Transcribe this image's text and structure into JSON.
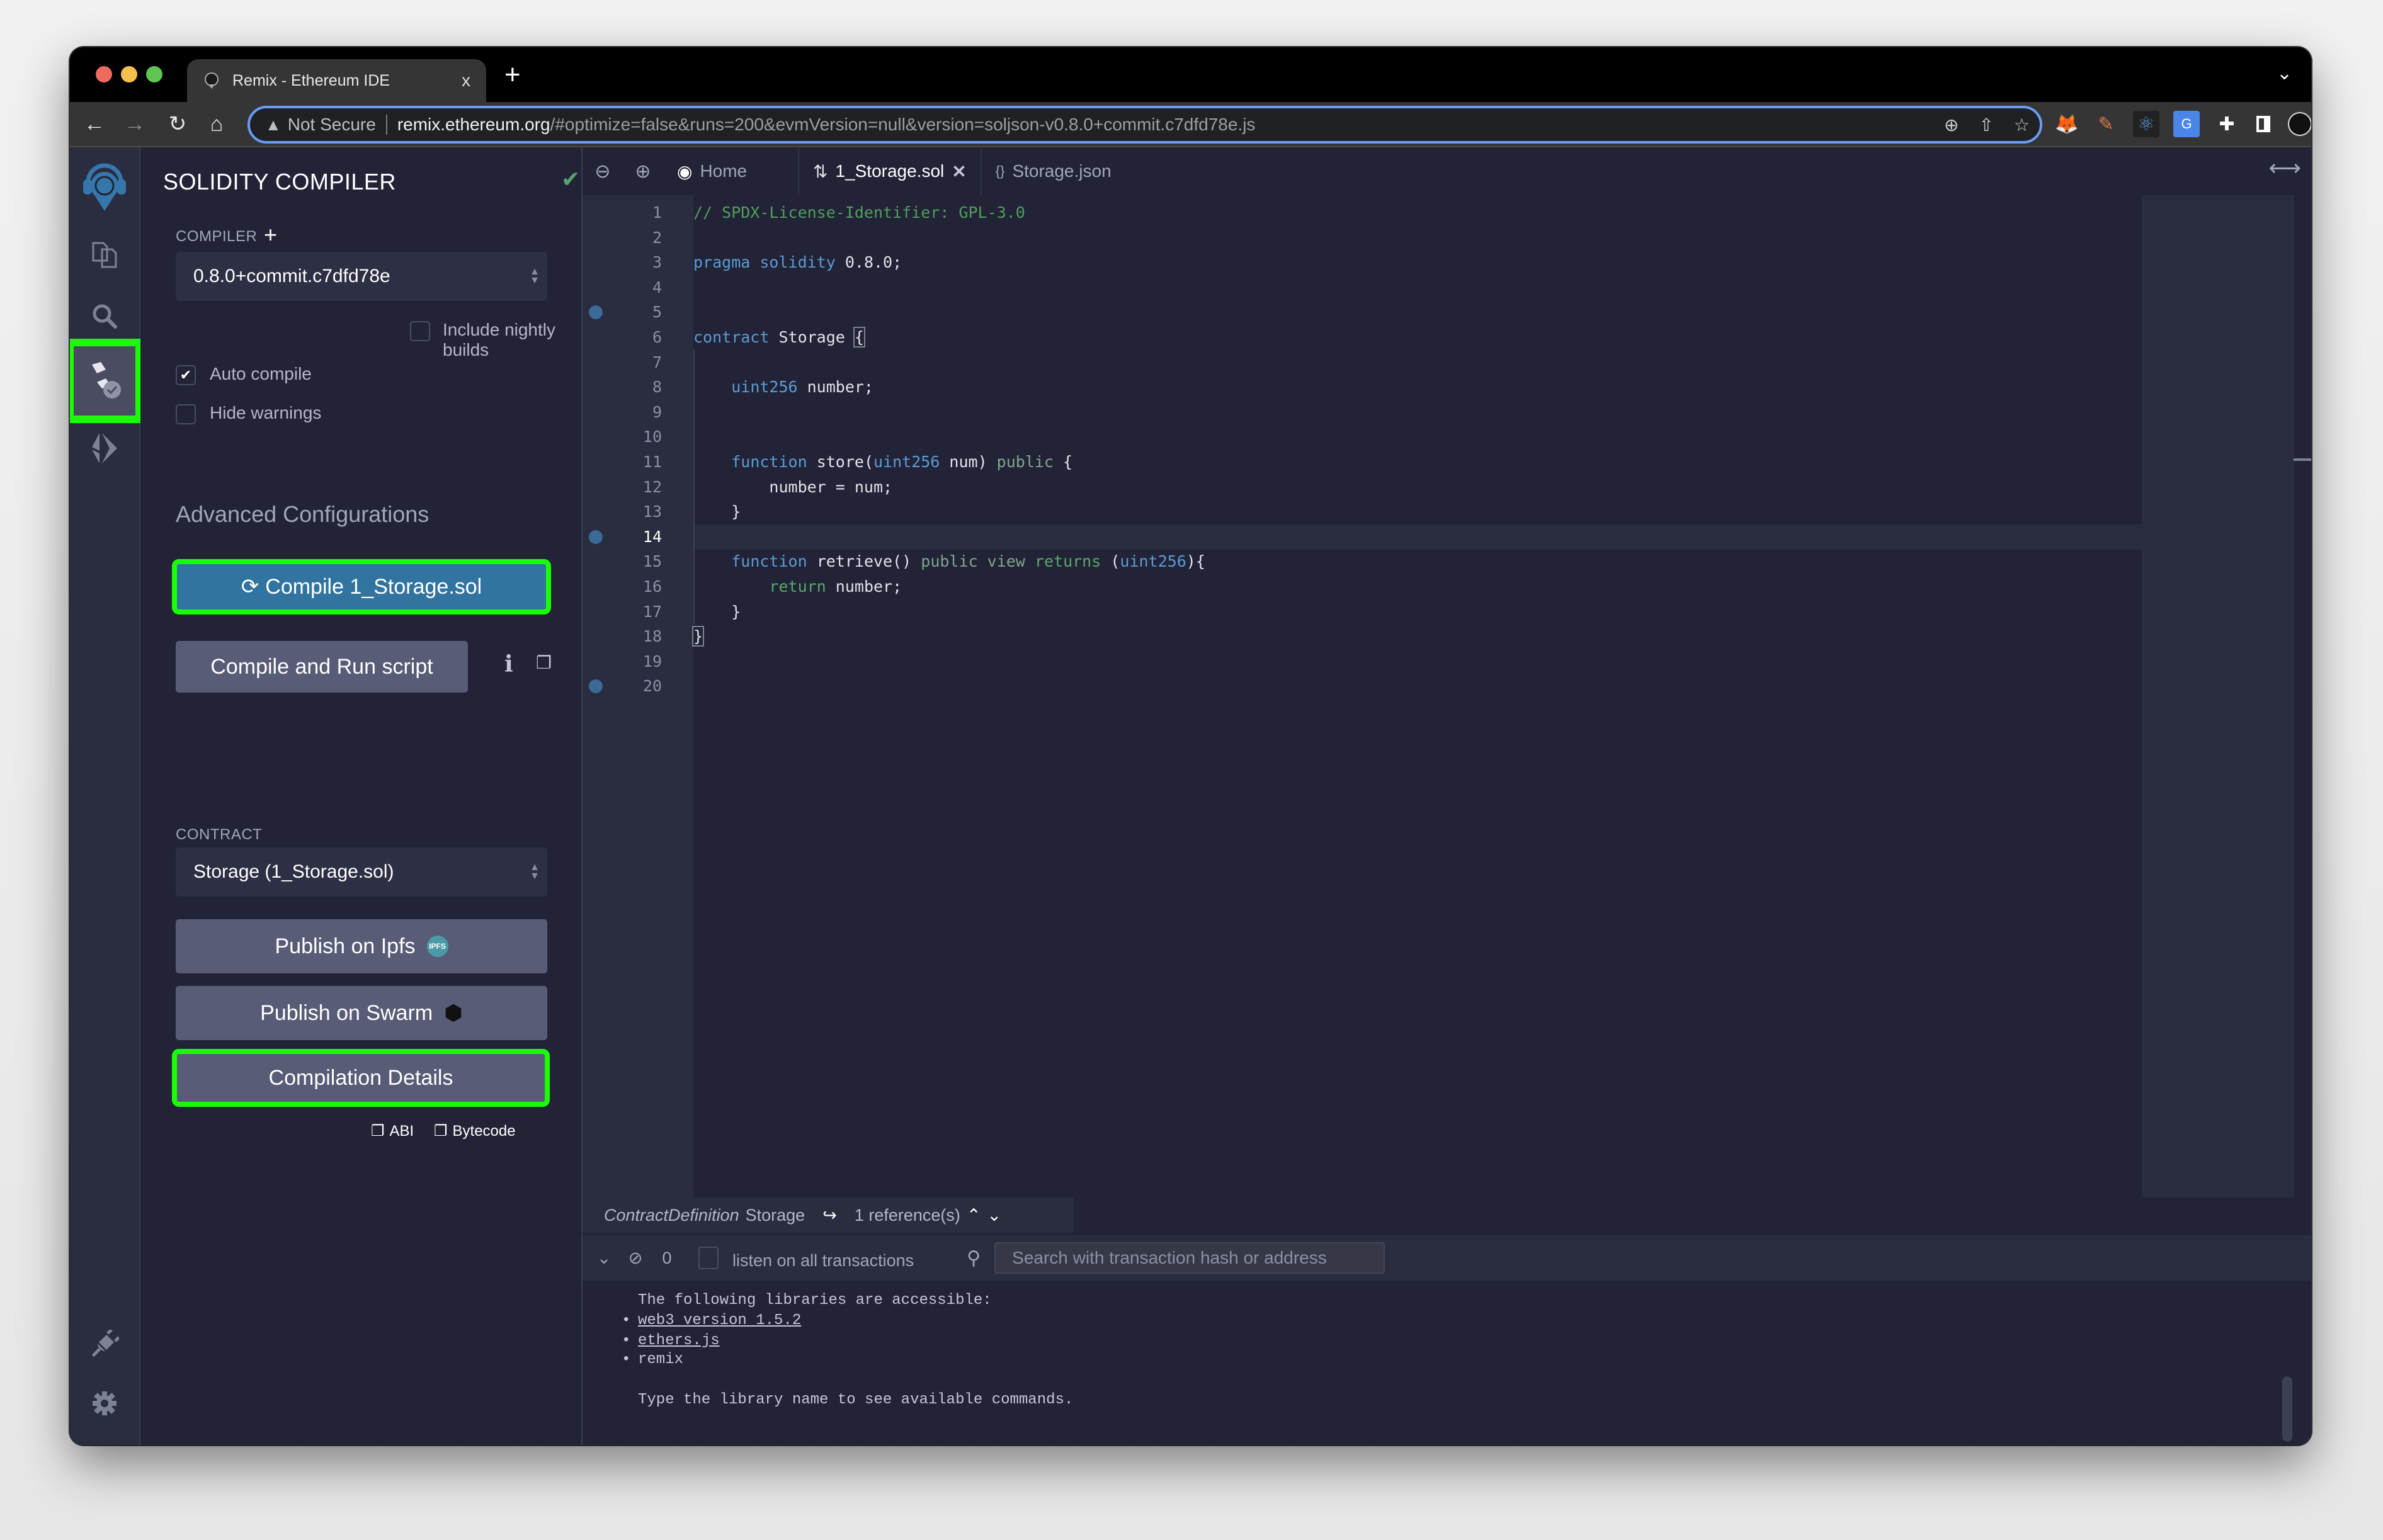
{
  "browser": {
    "tab_title": "Remix - Ethereum IDE",
    "tab_close": "x",
    "new_tab": "+",
    "address": {
      "security_label": "Not Secure",
      "host": "remix.ethereum.org",
      "path": "/#optimize=false&runs=200&evmVersion=null&version=soljson-v0.8.0+commit.c7dfd78e.js"
    },
    "extensions": [
      "metamask-icon",
      "eyedropper-icon",
      "react-devtools-icon",
      "google-translate-icon",
      "extensions-puzzle-icon",
      "sidebar-toggle-icon",
      "profile-avatar",
      "menu-kebab-icon"
    ]
  },
  "icon_sidebar": {
    "items": [
      "remix-logo",
      "file-explorer",
      "search",
      "solidity-compiler",
      "deploy-run"
    ],
    "bottom_items": [
      "plugin-manager",
      "settings"
    ],
    "active": "solidity-compiler"
  },
  "compiler_panel": {
    "title": "SOLIDITY COMPILER",
    "compiler_label": "COMPILER",
    "compiler_version": "0.8.0+commit.c7dfd78e",
    "include_nightly_label": "Include nightly builds",
    "include_nightly_checked": false,
    "auto_compile_label": "Auto compile",
    "auto_compile_checked": true,
    "hide_warnings_label": "Hide warnings",
    "hide_warnings_checked": false,
    "advanced_label": "Advanced Configurations",
    "compile_button": "Compile 1_Storage.sol",
    "compile_run_button": "Compile and Run script",
    "contract_label": "CONTRACT",
    "contract_selected": "Storage (1_Storage.sol)",
    "publish_ipfs": "Publish on Ipfs",
    "ipfs_badge": "IPFS",
    "publish_swarm": "Publish on Swarm",
    "compilation_details": "Compilation Details",
    "abi_label": "ABI",
    "bytecode_label": "Bytecode"
  },
  "editor": {
    "tabs": [
      {
        "label": "Home",
        "icon": "remix-logo"
      },
      {
        "label": "1_Storage.sol",
        "icon": "solidity-icon",
        "active": true,
        "closable": true
      },
      {
        "label": "Storage.json",
        "icon": "json-braces-icon"
      }
    ],
    "current_line": 14,
    "breakpoint_lines": [
      5,
      14,
      20
    ],
    "lines": [
      [
        [
          "comment",
          "// SPDX-License-Identifier: GPL-3.0"
        ]
      ],
      [],
      [
        [
          "kw",
          "pragma"
        ],
        [
          "plain",
          " "
        ],
        [
          "kw",
          "solidity"
        ],
        [
          "plain",
          " 0.8.0;"
        ]
      ],
      [],
      [],
      [
        [
          "kw",
          "contract"
        ],
        [
          "plain",
          " Storage "
        ],
        [
          "bracket",
          "{"
        ]
      ],
      [],
      [
        [
          "plain",
          "    "
        ],
        [
          "kw",
          "uint256"
        ],
        [
          "plain",
          " number;"
        ]
      ],
      [],
      [],
      [
        [
          "plain",
          "    "
        ],
        [
          "kw",
          "function"
        ],
        [
          "plain",
          " store("
        ],
        [
          "kw",
          "uint256"
        ],
        [
          "plain",
          " num) "
        ],
        [
          "mod",
          "public"
        ],
        [
          "plain",
          " {"
        ]
      ],
      [
        [
          "plain",
          "        number = num;"
        ]
      ],
      [
        [
          "plain",
          "    }"
        ]
      ],
      [],
      [
        [
          "plain",
          "    "
        ],
        [
          "kw",
          "function"
        ],
        [
          "plain",
          " retrieve() "
        ],
        [
          "mod",
          "public"
        ],
        [
          "plain",
          " "
        ],
        [
          "mod",
          "view"
        ],
        [
          "plain",
          " "
        ],
        [
          "green",
          "returns"
        ],
        [
          "plain",
          " ("
        ],
        [
          "kw",
          "uint256"
        ],
        [
          "plain",
          "){"
        ]
      ],
      [
        [
          "plain",
          "        "
        ],
        [
          "green",
          "return"
        ],
        [
          "plain",
          " number;"
        ]
      ],
      [
        [
          "plain",
          "    }"
        ]
      ],
      [
        [
          "bracket",
          "}"
        ]
      ],
      [],
      []
    ]
  },
  "reference_bar": {
    "kind": "ContractDefinition",
    "name": "Storage",
    "references": "1 reference(s)"
  },
  "terminal": {
    "pending_count": "0",
    "listen_label": "listen on all transactions",
    "listen_checked": false,
    "search_placeholder": "Search with transaction hash or address",
    "intro": "The following libraries are accessible:",
    "libraries": [
      {
        "label": "web3 version 1.5.2",
        "link": true
      },
      {
        "label": "ethers.js",
        "link": true
      },
      {
        "label": "remix",
        "link": false
      }
    ],
    "hint": "Type the library name to see available commands.",
    "prompt": ">"
  }
}
